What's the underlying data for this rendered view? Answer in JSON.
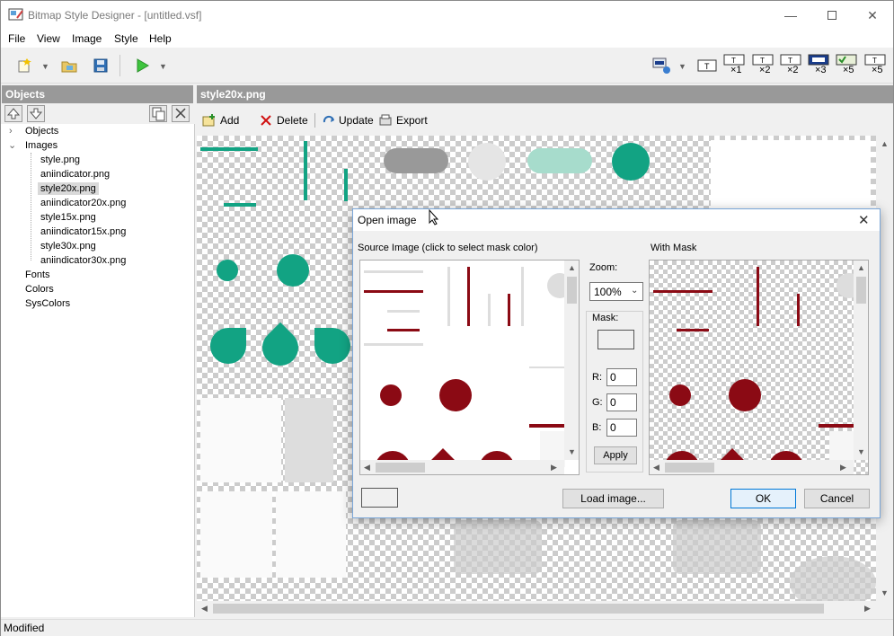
{
  "window": {
    "title": "Bitmap Style Designer - [untitled.vsf]"
  },
  "menu": [
    "File",
    "View",
    "Image",
    "Style",
    "Help"
  ],
  "objects_panel": {
    "header": "Objects"
  },
  "tree": {
    "root_objects": "Objects",
    "images": "Images",
    "image_items": [
      "style.png",
      "aniindicator.png",
      "style20x.png",
      "aniindicator20x.png",
      "style15x.png",
      "aniindicator15x.png",
      "style30x.png",
      "aniindicator30x.png"
    ],
    "selected_item": "style20x.png",
    "fonts": "Fonts",
    "colors": "Colors",
    "syscolors": "SysColors"
  },
  "image_panel": {
    "header": "style20x.png",
    "add": "Add",
    "delete": "Delete",
    "update": "Update",
    "export": "Export"
  },
  "scale_buttons": [
    "×1",
    "×2",
    "×2",
    "×3",
    "×5",
    "×5"
  ],
  "dialog": {
    "title": "Open image",
    "source_label": "Source Image (click to select mask color)",
    "mask_view_label": "With Mask",
    "zoom_label": "Zoom:",
    "zoom_value": "100%",
    "mask_label": "Mask:",
    "r_label": "R:",
    "r_value": "0",
    "g_label": "G:",
    "g_value": "0",
    "b_label": "B:",
    "b_value": "0",
    "apply": "Apply",
    "load": "Load image...",
    "ok": "OK",
    "cancel": "Cancel"
  },
  "status": {
    "text": "Modified"
  },
  "colors": {
    "accent": "#12a383",
    "mask_color": "#8b0a14"
  }
}
